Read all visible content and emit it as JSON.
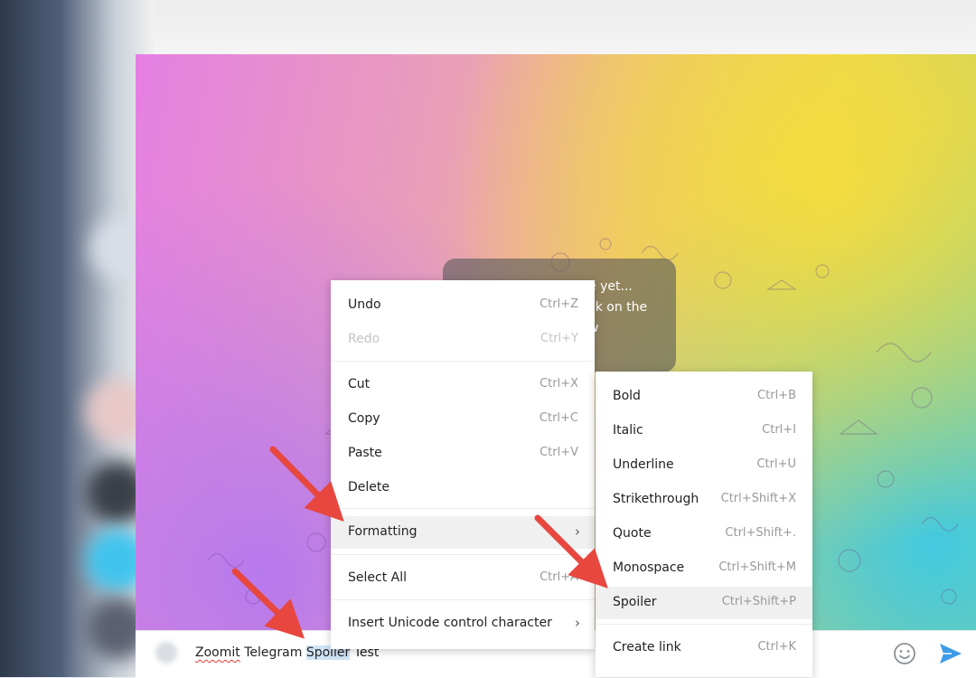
{
  "chat": {
    "empty_line1": "e yet...",
    "empty_line2": "ck on the",
    "empty_line3": "w"
  },
  "composer": {
    "word1": "Zoomit",
    "word2": " Telegram ",
    "word3": "Spoiler",
    "word4": " Test"
  },
  "context_menu": {
    "items": [
      {
        "label": "Undo",
        "shortcut": "Ctrl+Z"
      },
      {
        "label": "Redo",
        "shortcut": "Ctrl+Y",
        "disabled": true
      },
      {
        "label": "Cut",
        "shortcut": "Ctrl+X"
      },
      {
        "label": "Copy",
        "shortcut": "Ctrl+C"
      },
      {
        "label": "Paste",
        "shortcut": "Ctrl+V"
      },
      {
        "label": "Delete",
        "shortcut": ""
      },
      {
        "label": "Formatting",
        "shortcut": ""
      },
      {
        "label": "Select All",
        "shortcut": "Ctrl+A"
      },
      {
        "label": "Insert Unicode control character",
        "shortcut": ""
      }
    ]
  },
  "formatting_menu": {
    "items": [
      {
        "label": "Bold",
        "shortcut": "Ctrl+B"
      },
      {
        "label": "Italic",
        "shortcut": "Ctrl+I"
      },
      {
        "label": "Underline",
        "shortcut": "Ctrl+U"
      },
      {
        "label": "Strikethrough",
        "shortcut": "Ctrl+Shift+X"
      },
      {
        "label": "Quote",
        "shortcut": "Ctrl+Shift+."
      },
      {
        "label": "Monospace",
        "shortcut": "Ctrl+Shift+M"
      },
      {
        "label": "Spoiler",
        "shortcut": "Ctrl+Shift+P"
      },
      {
        "label": "Create link",
        "shortcut": "Ctrl+K"
      }
    ]
  },
  "icons": {
    "submenu_arrow": "chevron-right-icon",
    "emoji": "emoji-icon",
    "send": "send-icon",
    "attach": "attach-icon",
    "annotation": "red-arrow-icon"
  },
  "colors": {
    "send_accent": "#3d9ce8",
    "annotation_arrow": "#e8473f",
    "selection": "#cfe4f7"
  }
}
